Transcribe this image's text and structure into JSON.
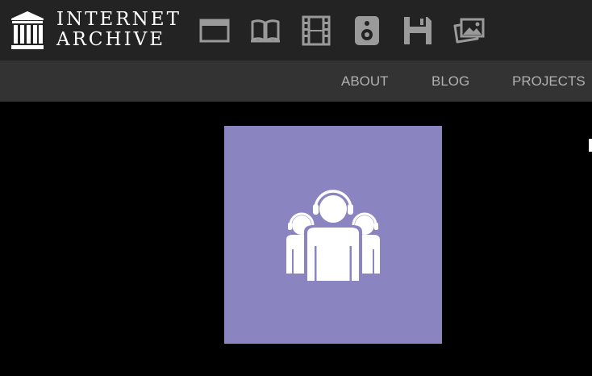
{
  "header": {
    "logo": {
      "line1": "INTERNET",
      "line2": "ARCHIVE",
      "icon": "archive-building-icon"
    },
    "media_icons": [
      {
        "name": "web-icon",
        "title": "Web"
      },
      {
        "name": "texts-icon",
        "title": "Texts"
      },
      {
        "name": "video-icon",
        "title": "Video"
      },
      {
        "name": "audio-icon",
        "title": "Audio"
      },
      {
        "name": "software-icon",
        "title": "Software"
      },
      {
        "name": "images-icon",
        "title": "Images"
      }
    ]
  },
  "subnav": {
    "items": [
      "ABOUT",
      "BLOG",
      "PROJECTS"
    ]
  },
  "main": {
    "tile_icon": "people-headphones-icon"
  },
  "colors": {
    "topbar": "#232323",
    "subnav": "#333333",
    "icon_gray": "#9a9a9a",
    "tile": "#8a84c1",
    "page_background": "#000000"
  }
}
